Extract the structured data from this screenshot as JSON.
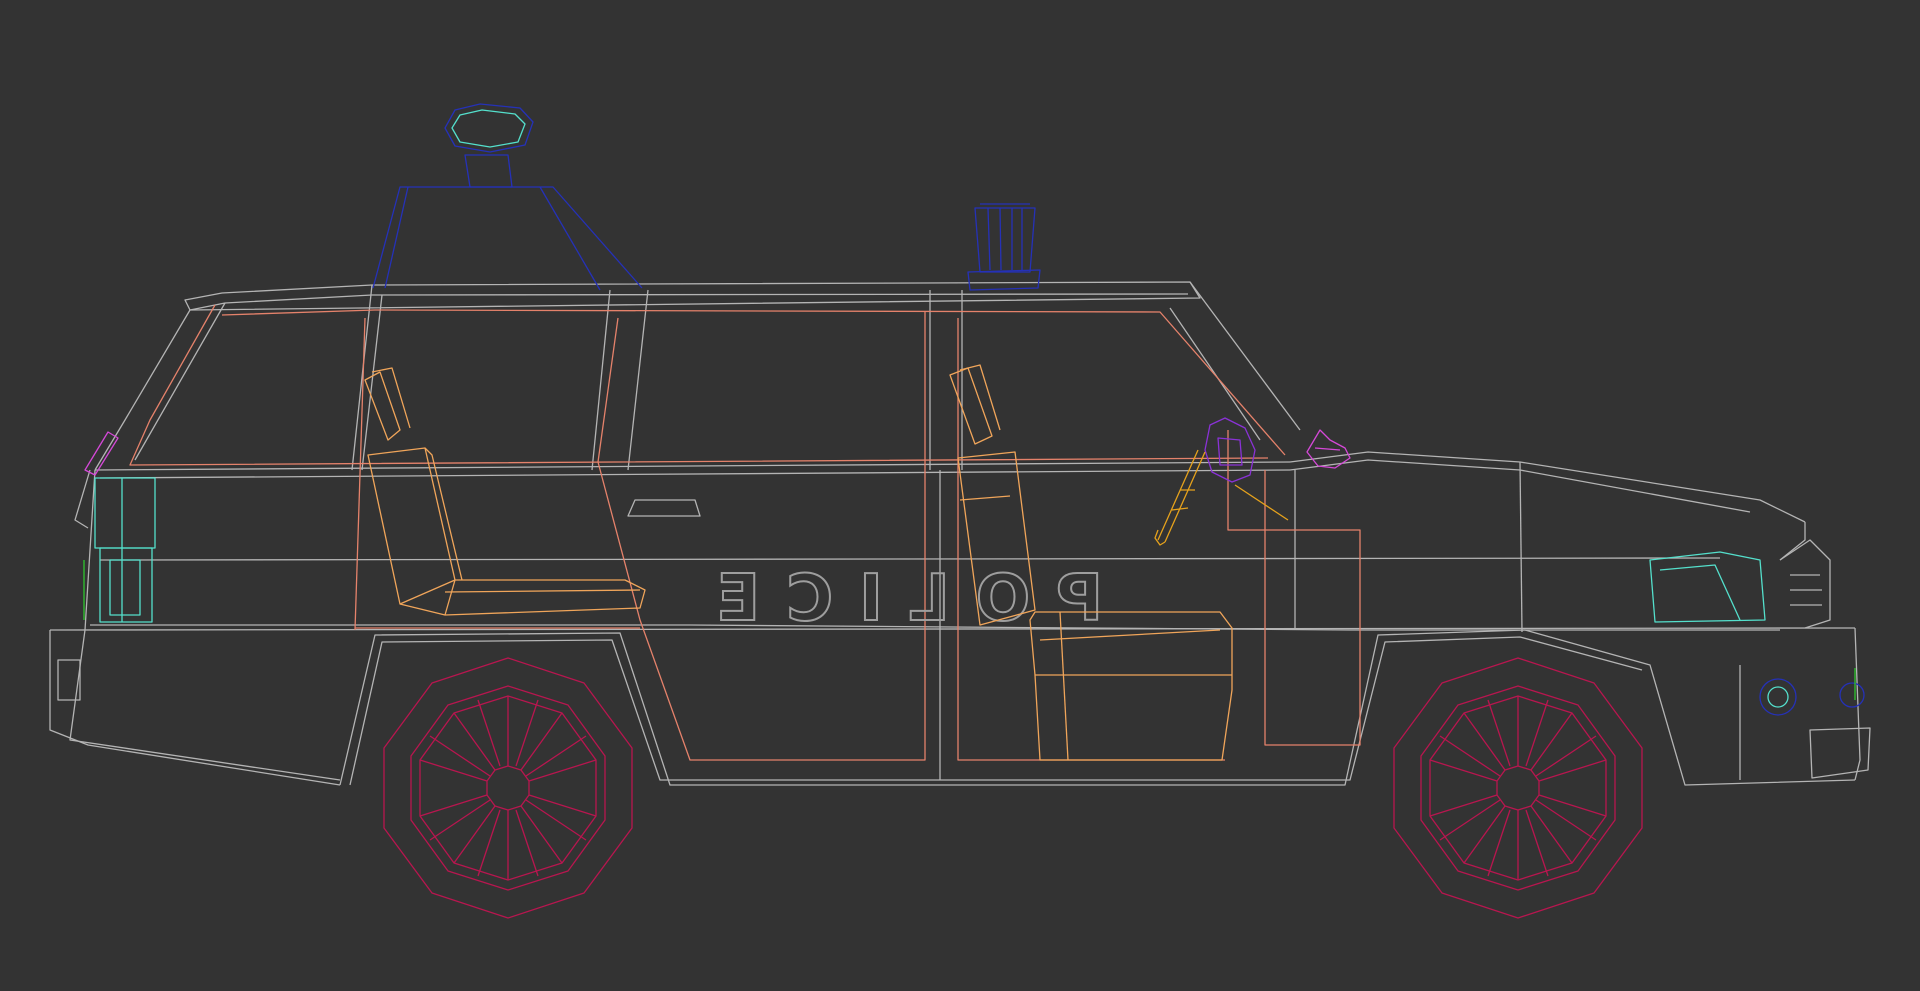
{
  "viewport": {
    "background": "#333333"
  },
  "model": {
    "door_label": "POLICE",
    "wire_colors": {
      "body": "#b4b4b4",
      "frame": "#e5826b",
      "seats": "#f0a55a",
      "wheels": "#b8164f",
      "roof_equipment": "#2531b8",
      "lights": "#54e0cc",
      "steering_wheel": "#8a32d6",
      "mirrors": "#d548d8",
      "shotgun_rack": "#e6a21c"
    }
  }
}
